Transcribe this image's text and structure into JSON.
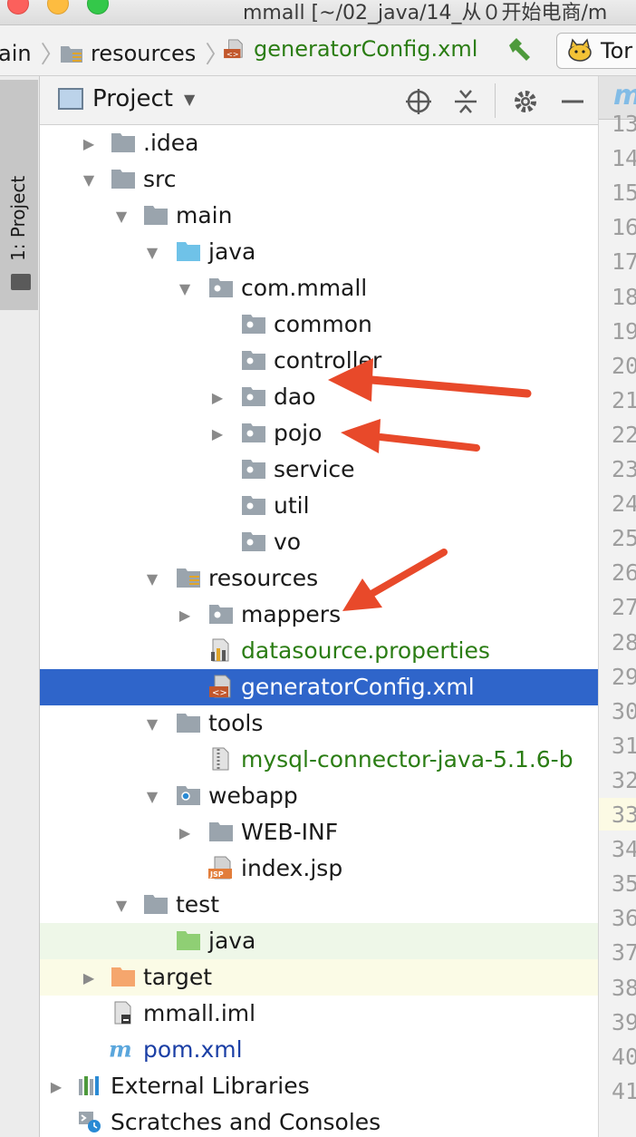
{
  "window": {
    "title": "mmall [~/02_java/14_从０开始电商/m"
  },
  "navbar": {
    "crumbs": [
      {
        "label": "ain"
      },
      {
        "label": "resources"
      },
      {
        "label": "generatorConfig.xml"
      }
    ],
    "run_config_label": "Tor"
  },
  "toolstrip": {
    "project_tab_label": "1: Project"
  },
  "panel": {
    "title": "Project"
  },
  "tree": {
    "items": [
      {
        "label": ".idea"
      },
      {
        "label": "src"
      },
      {
        "label": "main"
      },
      {
        "label": "java"
      },
      {
        "label": "com.mmall"
      },
      {
        "label": "common"
      },
      {
        "label": "controller"
      },
      {
        "label": "dao"
      },
      {
        "label": "pojo"
      },
      {
        "label": "service"
      },
      {
        "label": "util"
      },
      {
        "label": "vo"
      },
      {
        "label": "resources"
      },
      {
        "label": "mappers"
      },
      {
        "label": "datasource.properties"
      },
      {
        "label": "generatorConfig.xml"
      },
      {
        "label": "tools"
      },
      {
        "label": "mysql-connector-java-5.1.6-b"
      },
      {
        "label": "webapp"
      },
      {
        "label": "WEB-INF"
      },
      {
        "label": "index.jsp"
      },
      {
        "label": "test"
      },
      {
        "label": "java"
      },
      {
        "label": "target"
      },
      {
        "label": "mmall.iml"
      },
      {
        "label": "pom.xml"
      },
      {
        "label": "External Libraries"
      },
      {
        "label": "Scratches and Consoles"
      }
    ]
  },
  "gutter": {
    "line_numbers": [
      "13",
      "14",
      "15",
      "16",
      "17",
      "18",
      "19",
      "20",
      "21",
      "22",
      "23",
      "24",
      "25",
      "26",
      "27",
      "28",
      "29",
      "30",
      "31",
      "32",
      "33",
      "34",
      "35",
      "36",
      "37",
      "38",
      "39",
      "40",
      "41"
    ]
  },
  "colors": {
    "selection": "#2f65ca",
    "annotation_arrow": "#e8492a",
    "resource_file_text": "#2b7d14",
    "maven_file_text": "#1b3fa5"
  }
}
